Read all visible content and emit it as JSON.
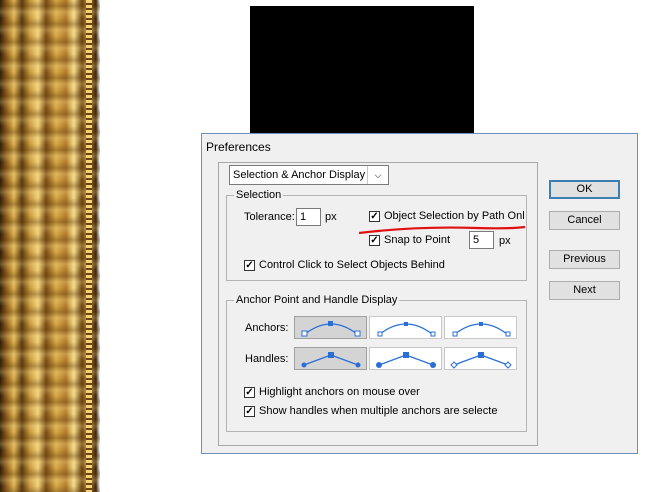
{
  "dialog": {
    "title": "Preferences"
  },
  "section_dropdown": {
    "value": "Selection & Anchor Display"
  },
  "selection_group": {
    "legend": "Selection",
    "tolerance_label": "Tolerance:",
    "tolerance_value": "1",
    "tolerance_unit": "px",
    "object_selection_label": "Object Selection by Path Onl",
    "object_selection_checked": true,
    "snap_label": "Snap to Point",
    "snap_checked": true,
    "snap_value": "5",
    "snap_unit": "px",
    "control_click_label": "Control Click to Select Objects Behind",
    "control_click_checked": true
  },
  "anchor_group": {
    "legend": "Anchor Point and Handle Display",
    "anchors_label": "Anchors:",
    "handles_label": "Handles:",
    "anchor_styles": [
      "anchor-style-1",
      "anchor-style-2",
      "anchor-style-3"
    ],
    "handle_styles": [
      "handle-style-1",
      "handle-style-2",
      "handle-style-3"
    ],
    "selected_anchor_style": 1,
    "selected_handle_style": 1,
    "highlight_label": "Highlight anchors on mouse over",
    "highlight_checked": true,
    "show_handles_label": "Show handles when multiple anchors are selecte",
    "show_handles_checked": true
  },
  "buttons": {
    "ok": "OK",
    "cancel": "Cancel",
    "previous": "Previous",
    "next": "Next"
  },
  "colors": {
    "accent": "#3c7fb1",
    "swatch_blue": "#2b6fd6",
    "annotation_red": "#e01010"
  }
}
